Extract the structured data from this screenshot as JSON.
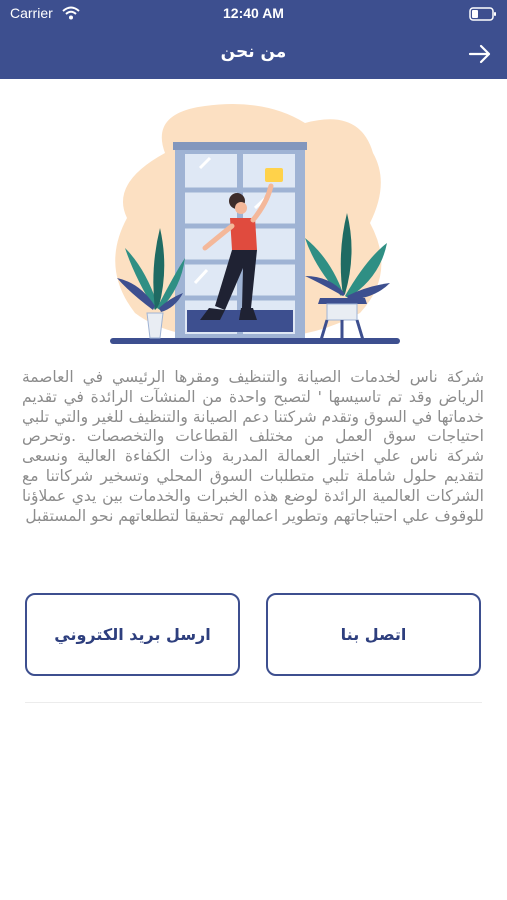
{
  "status_bar": {
    "carrier": "Carrier",
    "time": "12:40 AM",
    "icons": [
      "wifi-icon",
      "battery-icon"
    ]
  },
  "nav": {
    "title": "من نحن",
    "back_icon": "arrow-right-icon"
  },
  "hero": {
    "illustration": "woman-cleaning-window-illustration",
    "colors": {
      "blob": "#fce0c2",
      "frame": "#9fb3d4",
      "glass": "#dfe8f5",
      "plant": "#2f8f84",
      "shirt": "#e04b3e",
      "base": "#3d4f8f"
    }
  },
  "about": {
    "text": "شركة ناس لخدمات الصيانة والتنظيف ومقرها الرئيسي في العاصمة الرياض وقد تم تاسيسها ' لتصبح واحدة من المنشآت الرائدة في تقديم خدماتها في السوق وتقدم شركتنا دعم الصيانة والتنظيف للغير والتي تلبي احتياجات سوق العمل من مختلف القطاعات والتخصصات .وتحرص شركة ناس علي اختيار العمالة المدربة وذات الكفاءة العالية ونسعى لتقديم حلول شاملة تلبي متطلبات السوق المحلي وتسخير شركاتنا مع الشركات العالمية الرائدة لوضع هذه الخبرات والخدمات بين يدي عملاؤنا للوقوف علي احتياجاتهم وتطوير اعمالهم تحقيقا لتطلعاتهم نحو المستقبل"
  },
  "actions": {
    "contact_label": "اتصل بنا",
    "email_label": "ارسل بريد الكتروني"
  },
  "theme": {
    "primary": "#3d4f8f",
    "text_gray": "#8c8c8c"
  }
}
